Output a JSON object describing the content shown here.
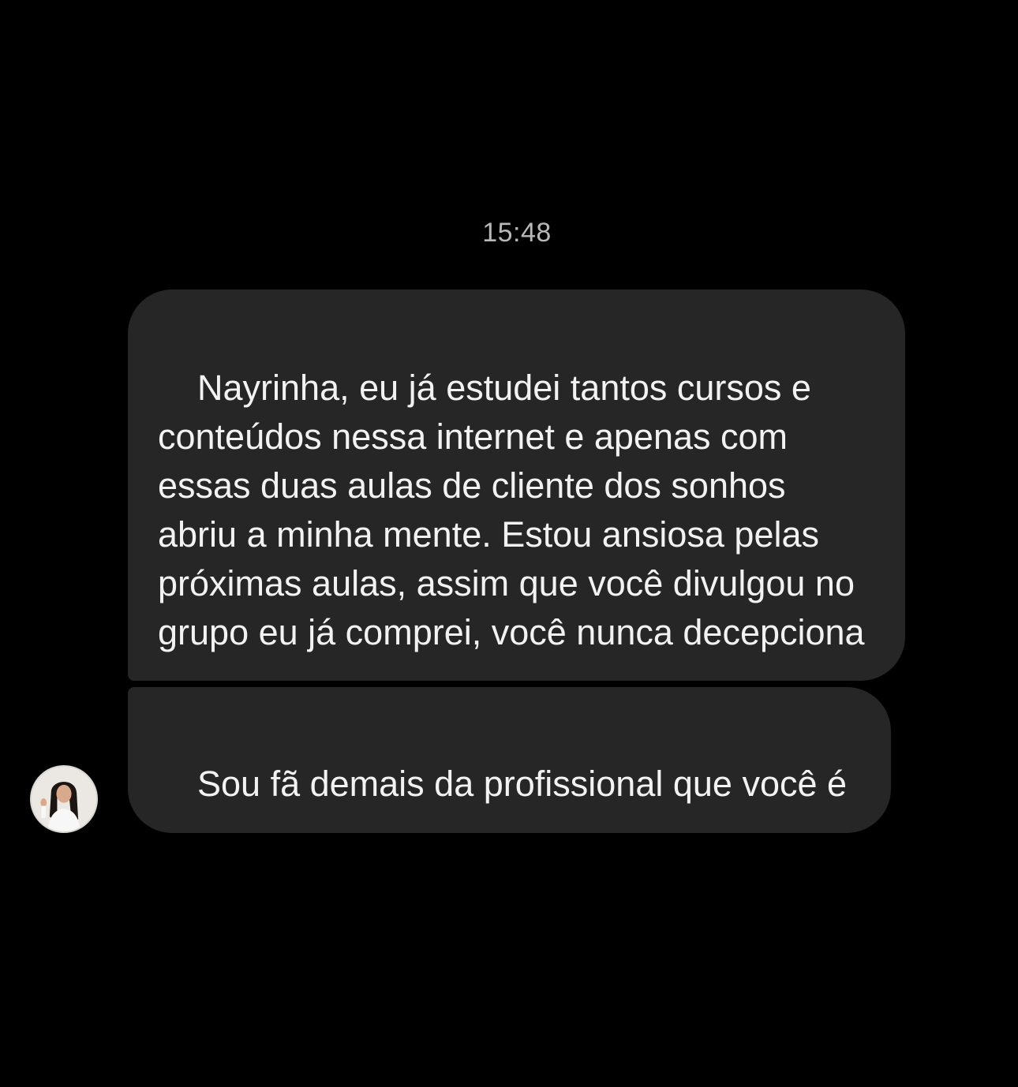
{
  "chat": {
    "timestamp": "15:48",
    "messages": [
      {
        "text": "Nayrinha, eu já estudei tantos cursos e conteúdos nessa internet e apenas com essas duas aulas de cliente dos sonhos abriu a minha mente. Estou ansiosa pelas próximas aulas, assim que você divulgou no grupo eu já comprei, você nunca decepciona"
      },
      {
        "text": "Sou fã demais da profissional que você é"
      }
    ],
    "sender_avatar_icon": "avatar-photo",
    "colors": {
      "background": "#000000",
      "bubble": "#262626",
      "text": "#f2f2f2",
      "timestamp": "#b8b8b8"
    }
  }
}
